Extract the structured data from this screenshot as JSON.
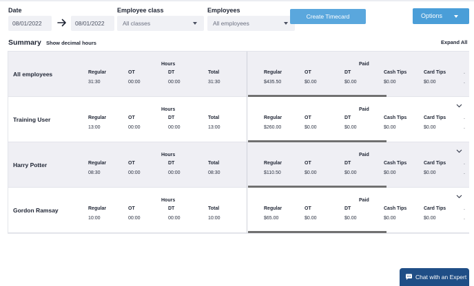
{
  "filters": {
    "date_label": "Date",
    "start_date": "08/01/2022",
    "end_date": "08/01/2022",
    "employee_class_label": "Employee class",
    "employee_class_value": "All classes",
    "employees_label": "Employees",
    "employees_value": "All employees",
    "create_button": "Create Timecard",
    "options_button": "Options"
  },
  "summary": {
    "title": "Summary",
    "decimal_toggle": "Show decimal hours",
    "expand_all": "Expand All"
  },
  "headers": {
    "hours": "Hours",
    "paid": "Paid",
    "regular": "Regular",
    "ot": "OT",
    "dt": "DT",
    "total": "Total",
    "cash_tips": "Cash Tips",
    "card_tips": "Card Tips"
  },
  "rows": [
    {
      "name": "All employees",
      "hours": {
        "regular": "31:30",
        "ot": "00:00",
        "dt": "00:00",
        "total": "31:30"
      },
      "paid": {
        "regular": "$435.50",
        "ot": "$0.00",
        "dt": "$0.00",
        "cash_tips": "$0.00",
        "card_tips": "$0.00"
      }
    },
    {
      "name": "Training User",
      "hours": {
        "regular": "13:00",
        "ot": "00:00",
        "dt": "00:00",
        "total": "13:00"
      },
      "paid": {
        "regular": "$260.00",
        "ot": "$0.00",
        "dt": "$0.00",
        "cash_tips": "$0.00",
        "card_tips": "$0.00"
      }
    },
    {
      "name": "Harry Potter",
      "hours": {
        "regular": "08:30",
        "ot": "00:00",
        "dt": "00:00",
        "total": "08:30"
      },
      "paid": {
        "regular": "$110.50",
        "ot": "$0.00",
        "dt": "$0.00",
        "cash_tips": "$0.00",
        "card_tips": "$0.00"
      }
    },
    {
      "name": "Gordon Ramsay",
      "hours": {
        "regular": "10:00",
        "ot": "00:00",
        "dt": "00:00",
        "total": "10:00"
      },
      "paid": {
        "regular": "$65.00",
        "ot": "$0.00",
        "dt": "$0.00",
        "cash_tips": "$0.00",
        "card_tips": "$0.00"
      }
    }
  ],
  "chat": {
    "label": "Chat with an Expert"
  },
  "icons": {
    "arrow": "arrow-right-icon",
    "caret": "caret-down-icon",
    "chevron": "chevron-down-icon",
    "chat": "chat-bubble-icon"
  },
  "colors": {
    "primary_button": "#5aa7dd",
    "options_button": "#4a9ed8",
    "chat_button": "#1f4e86",
    "shaded_row": "#efeff4"
  }
}
